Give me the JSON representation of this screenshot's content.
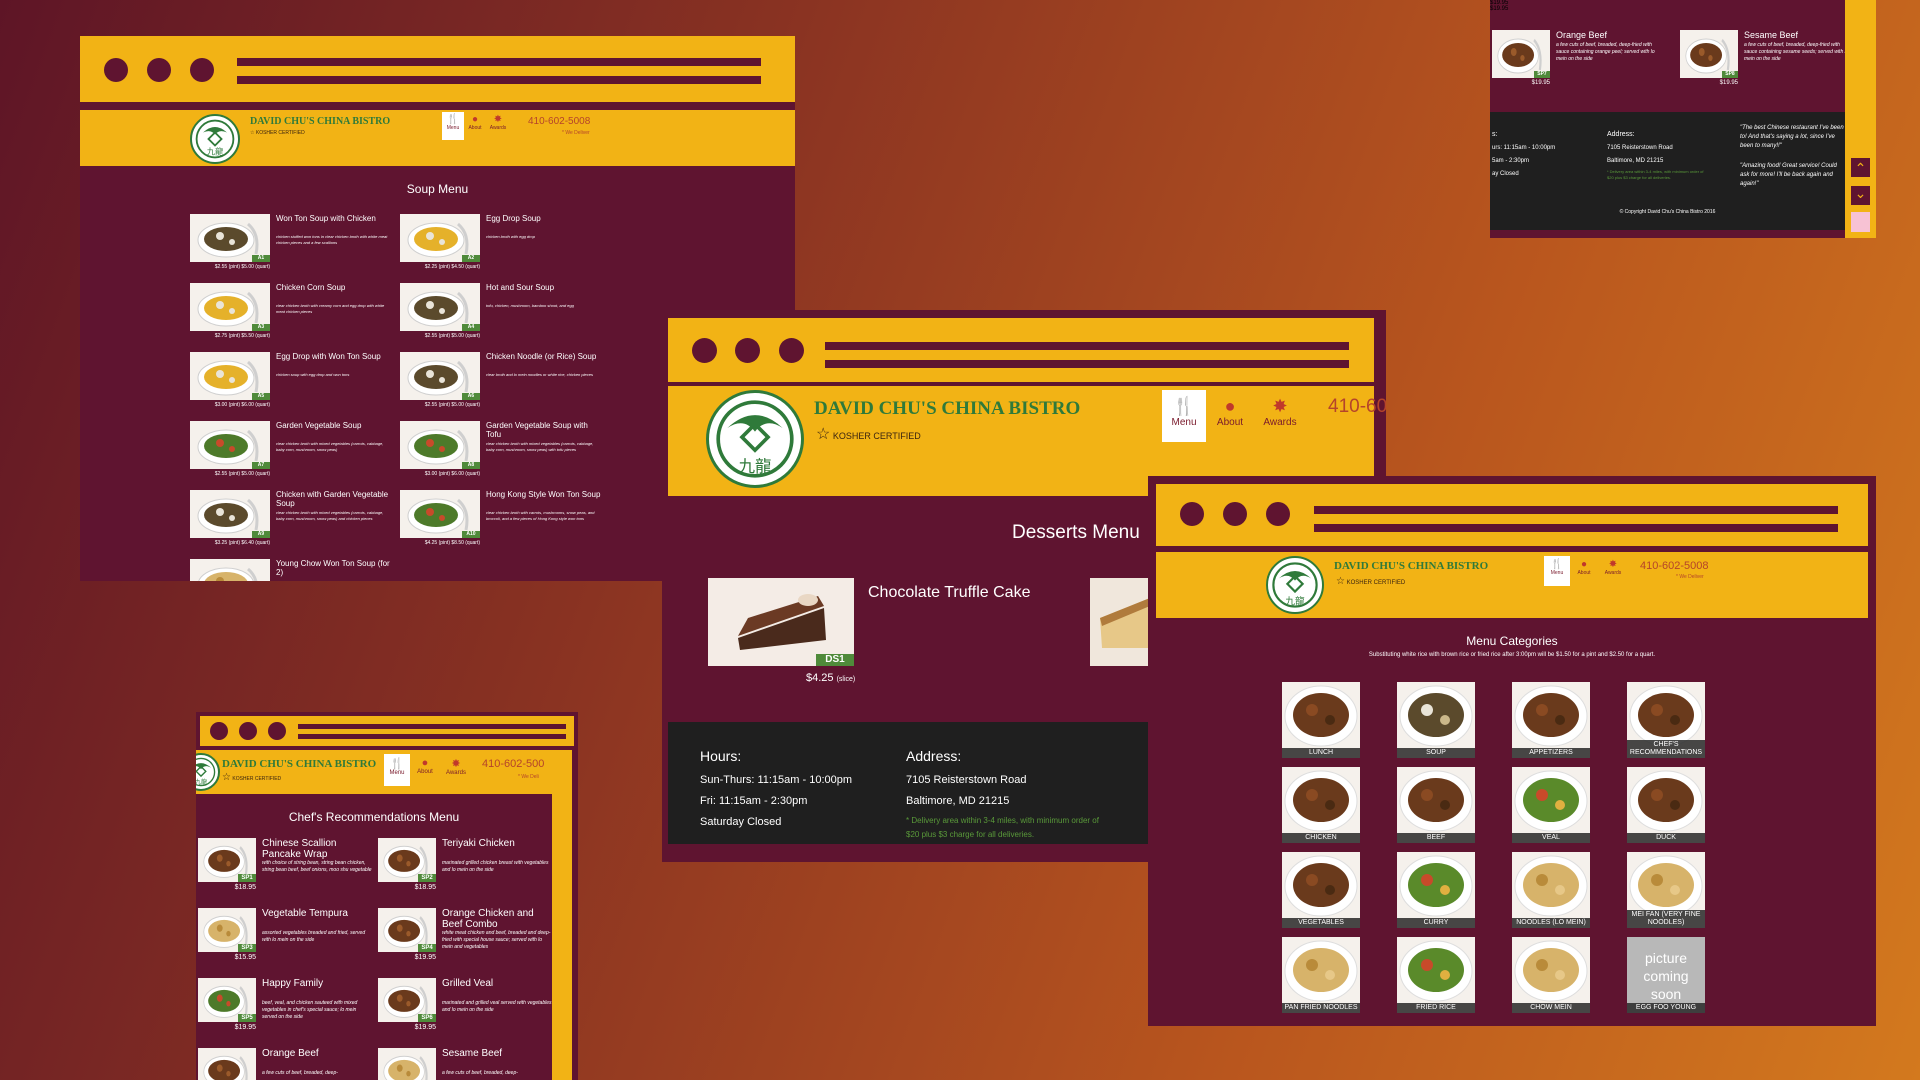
{
  "brand": {
    "name": "DAVID CHU'S CHINA BISTRO",
    "tagline": "KOSHER CERTIFIED",
    "phone": "410-602-5008",
    "phone_cropped": "410-60",
    "phone_cropped_small": "410-602-500",
    "deliver": "* We Deliver",
    "deliver_cropped": "* We Deli",
    "nav": [
      "Menu",
      "About",
      "Awards"
    ]
  },
  "soup": {
    "title": "Soup Menu",
    "items": [
      {
        "name": "Won Ton Soup with Chicken",
        "desc": "chicken stuffed won tons in clear chicken broth with white meat chicken pieces and a few scallions",
        "code": "A1",
        "price": "$2.55 (pint) $5.00 (quart)"
      },
      {
        "name": "Egg Drop Soup",
        "desc": "chicken broth with egg drop",
        "code": "A2",
        "price": "$2.25 (pint) $4.50 (quart)"
      },
      {
        "name": "Chicken Corn Soup",
        "desc": "clear chicken broth with creamy corn and egg drop with white meat chicken pieces",
        "code": "A3",
        "price": "$2.75 (pint) $5.50 (quart)"
      },
      {
        "name": "Hot and Sour Soup",
        "desc": "tofu, chicken, mushroom, bamboo shoot, and egg",
        "code": "A4",
        "price": "$2.55 (pint) $5.00 (quart)"
      },
      {
        "name": "Egg Drop with Won Ton Soup",
        "desc": "chicken soup with egg drop and won tons",
        "code": "A5",
        "price": "$3.00 (pint) $6.00 (quart)"
      },
      {
        "name": "Chicken Noodle (or Rice) Soup",
        "desc": "clear broth and lo mein noodles or white rice, chicken pieces",
        "code": "A6",
        "price": "$2.55 (pint) $5.00 (quart)"
      },
      {
        "name": "Garden Vegetable Soup",
        "desc": "clear chicken broth with mixed vegetables (carrots, cabbage, baby corn, mushroom, snow peas)",
        "code": "A7",
        "price": "$2.55 (pint) $5.00 (quart)"
      },
      {
        "name": "Garden Vegetable Soup with Tofu",
        "desc": "clear chicken broth with mixed vegetables (carrots, cabbage, baby corn, mushroom, snow peas) with tofu pieces",
        "code": "A8",
        "price": "$3.00 (pint) $6.00 (quart)"
      },
      {
        "name": "Chicken with Garden Vegetable Soup",
        "desc": "clear chicken broth with mixed vegetables (carrots, cabbage, baby corn, mushroom, snow peas) and chicken pieces",
        "code": "A9",
        "price": "$3.25 (pint) $6.40 (quart)"
      },
      {
        "name": "Hong Kong Style Won Ton Soup",
        "desc": "clear chicken broth with carrots, mushrooms, snow peas, and broccoli, and a few pieces of Hong Kong style won tons",
        "code": "A10",
        "price": "$4.25 (pint) $8.50 (quart)"
      },
      {
        "name": "Young Chow Won Ton Soup (for 2)",
        "desc": "",
        "code": "",
        "price": ""
      }
    ]
  },
  "desserts": {
    "title": "Desserts Menu",
    "item": {
      "name": "Chocolate Truffle Cake",
      "code": "DS1",
      "price": "$4.25",
      "unit": "(slice)"
    },
    "hours_label": "Hours:",
    "hours": [
      "Sun-Thurs: 11:15am - 10:00pm",
      "Fri: 11:15am - 2:30pm",
      "Saturday Closed"
    ],
    "address_label": "Address:",
    "address": [
      "7105 Reisterstown Road",
      "Baltimore, MD 21215"
    ],
    "delivery_note": "* Delivery area within 3-4 miles, with minimum order of $20 plus $3 charge for all deliveries."
  },
  "categories": {
    "title": "Menu Categories",
    "note": "Substituting white rice with brown rice or fried rice after 3:00pm will be $1.50 for a pint and $2.50 for a quart.",
    "items": [
      "LUNCH",
      "SOUP",
      "APPETIZERS",
      "CHEF'S RECOMMENDATIONS",
      "CHICKEN",
      "BEEF",
      "VEAL",
      "DUCK",
      "VEGETABLES",
      "CURRY",
      "NOODLES (LO MEIN)",
      "MEI FAN (VERY FINE NOODLES)",
      "PAN FRIED NOODLES",
      "FRIED RICE",
      "CHOW MEIN",
      "EGG FOO YOUNG"
    ],
    "soon_text": "picture coming soon"
  },
  "chef": {
    "title": "Chef's Recommendations Menu",
    "items": [
      {
        "name": "Chinese Scallion Pancake Wrap",
        "desc": "with choice of string bean, string bean chicken, string bean beef, beef onions, moo shu vegetable",
        "code": "SP1",
        "price": "$18.95"
      },
      {
        "name": "Teriyaki Chicken",
        "desc": "marinated grilled chicken breast with vegetables and lo mein on the side",
        "code": "SP2",
        "price": "$18.95"
      },
      {
        "name": "Vegetable Tempura",
        "desc": "assorted vegetables breaded and fried, served with lo mein on the side",
        "code": "SP3",
        "price": "$15.95"
      },
      {
        "name": "Orange Chicken and Beef Combo",
        "desc": "white meat chicken and beef, breaded and deep-fried with special house sauce; served with lo mein and vegetables",
        "code": "SP4",
        "price": "$19.95"
      },
      {
        "name": "Happy Family",
        "desc": "beef, veal, and chicken sauteed with mixed vegetables in chef's special sauce; lo mein served on the side",
        "code": "SP5",
        "price": "$19.95"
      },
      {
        "name": "Grilled Veal",
        "desc": "marinated and grilled veal served with vegetables and lo mein on the side",
        "code": "SP6",
        "price": "$19.95"
      },
      {
        "name": "Orange Beef",
        "desc": "a few cuts of beef, breaded, deep-",
        "code": "",
        "price": ""
      },
      {
        "name": "Sesame Beef",
        "desc": "a few cuts of beef, breaded, deep-",
        "code": "",
        "price": ""
      }
    ]
  },
  "footer_crop": {
    "prices_top": [
      "$19.95",
      "$19.95"
    ],
    "items": [
      {
        "name": "Orange Beef",
        "desc": "a few cuts of beef, breaded, deep-fried with sauce containing orange peel; served with lo mein on the side",
        "code": "SP7",
        "price": "$19.95"
      },
      {
        "name": "Sesame Beef",
        "desc": "a few cuts of beef, breaded, deep-fried with sauce containing sesame seeds; served with lo mein on the side",
        "code": "SP8",
        "price": "$19.95"
      }
    ],
    "hours_label": "s:",
    "hours": [
      "urs: 11:15am - 10:00pm",
      "5am - 2:30pm",
      "ay Closed"
    ],
    "address_label": "Address:",
    "address": [
      "7105 Reisterstown Road",
      "Baltimore, MD 21215"
    ],
    "delivery_note": "* Delivery area within 3-4 miles, with minimum order of $20 plus $3 charge for all deliveries.",
    "quote1": "\"The best Chinese restaurant I've been to! And that's saying a lot, since I've been to many!!\"",
    "quote2": "\"Amazing food! Great service! Could ask for more! I'll be back again and again!\"",
    "copyright": "© Copyright David Chu's China Bistro 2016"
  },
  "colors": {
    "maroon": "#5f1430",
    "gold": "#f2b315",
    "green": "#2f7a3a",
    "footer": "#1f1f1f"
  },
  "icons": [
    "dragon-logo",
    "fork-knife-icon",
    "info-icon",
    "award-icon",
    "star-icon",
    "chevron-up-icon",
    "chevron-down-icon"
  ]
}
